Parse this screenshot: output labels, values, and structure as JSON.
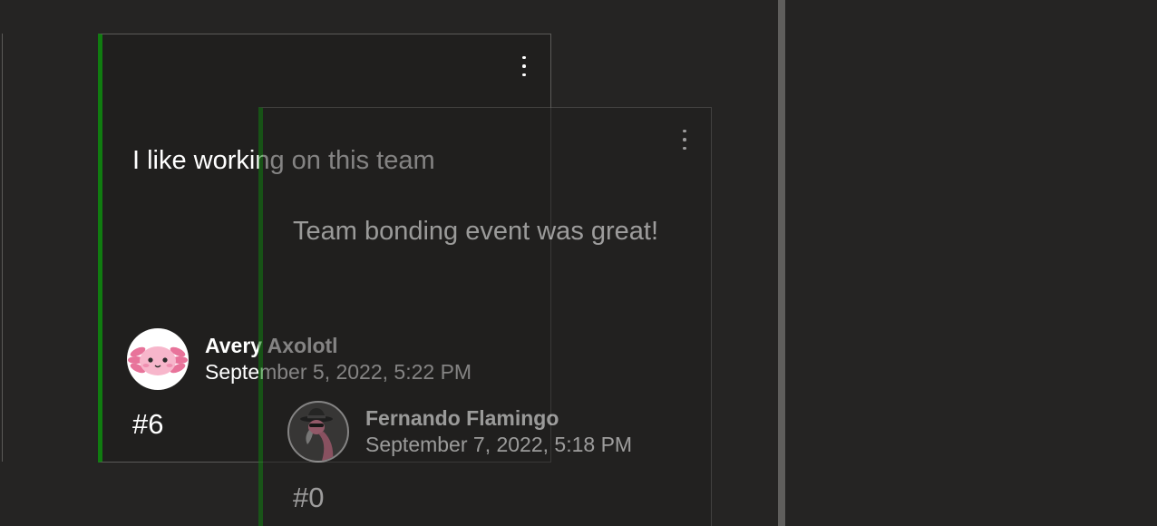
{
  "cards": [
    {
      "text": "I like working on this team",
      "author_name": "Avery Axolotl",
      "date": "September 5, 2022, 5:22 PM",
      "vote_label": "#6",
      "avatar_icon": "axolotl-avatar-icon",
      "accent_color": "#107c10"
    },
    {
      "text": "Team bonding event was great!",
      "author_name": "Fernando Flamingo",
      "date": "September 7, 2022, 5:18 PM",
      "vote_label": "#0",
      "avatar_icon": "flamingo-avatar-icon",
      "accent_color": "#107c10"
    }
  ]
}
